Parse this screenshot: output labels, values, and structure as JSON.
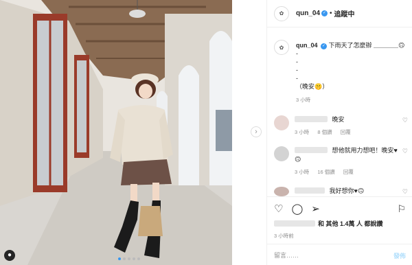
{
  "header": {
    "username": "qun_04",
    "separator": "•",
    "follow_state": "追蹤中"
  },
  "caption": {
    "username": "qun_04",
    "lines": [
      "下雨天了怎麼辦 ＿＿＿＿🙃",
      "-",
      "-",
      "-",
      "-",
      "（晚安🤫）"
    ],
    "time": "3 小時"
  },
  "comments": [
    {
      "text": "晚安",
      "time": "3 小時",
      "likes": "8 個讚",
      "reply": "回覆"
    },
    {
      "text": "想他就用力想吧！晚安♥🙃",
      "time": "3 小時",
      "likes": "16 個讚",
      "reply": "回覆"
    },
    {
      "text": "我好想你♥🙃"
    }
  ],
  "likes": {
    "text": "和 其他 1.4萬 人 都說讚"
  },
  "post_time": "3 小時前",
  "comment_box": {
    "placeholder": "留言……",
    "post_label": "發佈"
  },
  "icons": {
    "heart": "heart-icon",
    "comment": "comment-icon",
    "share": "share-icon",
    "bookmark": "bookmark-icon",
    "verified": "verified-badge-icon",
    "next": "chevron-right-icon"
  },
  "carousel": {
    "count": 5,
    "active": 1
  }
}
